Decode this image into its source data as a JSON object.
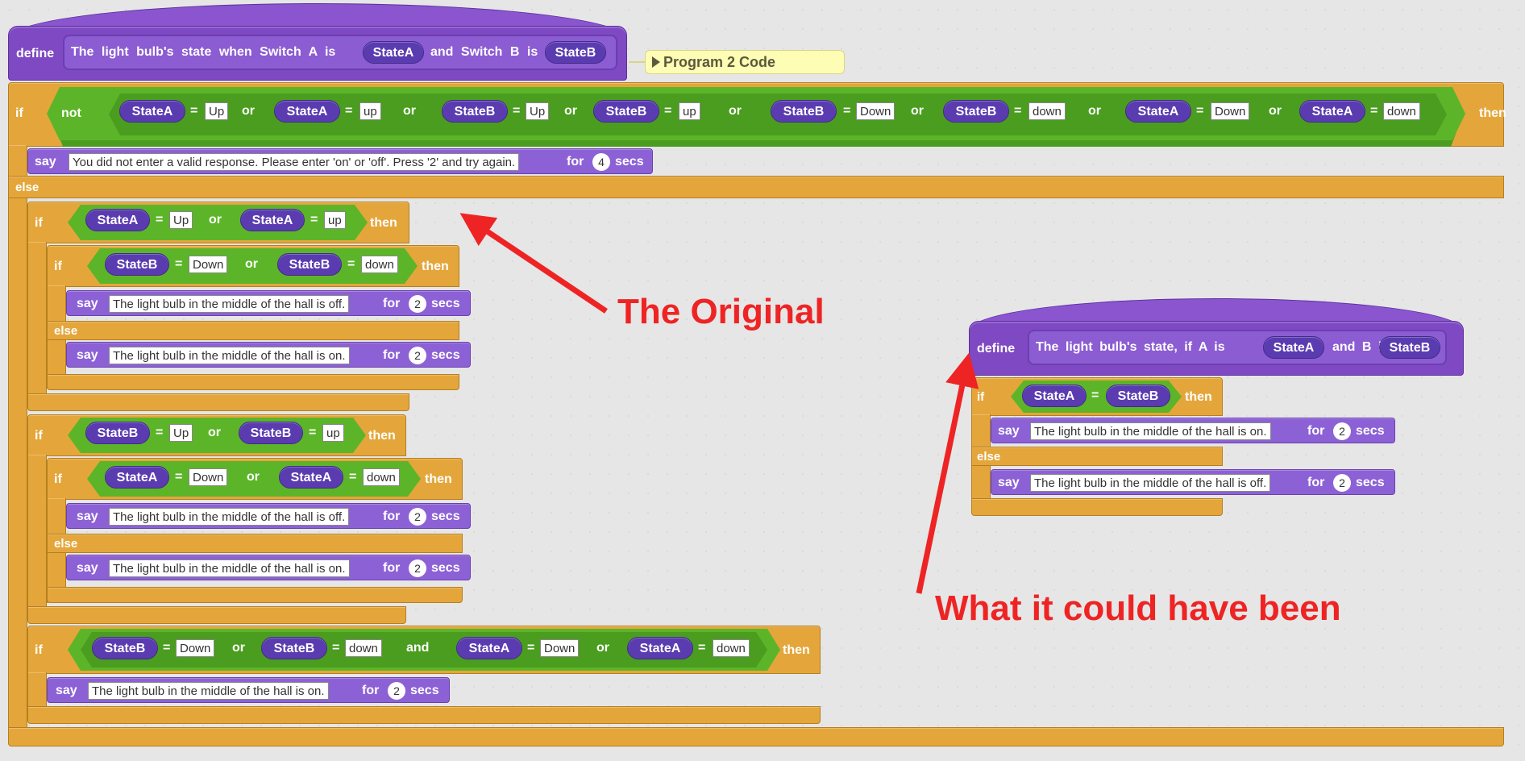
{
  "program1": {
    "define": "define",
    "proto_text": [
      "The light bulb's state when Switch A is",
      "and Switch B is"
    ],
    "proto_vars": [
      "StateA",
      "StateB"
    ],
    "note": "Program 2 Code",
    "if": "if",
    "then": "then",
    "else": "else",
    "not": "not",
    "or": "or",
    "and": "and",
    "eq": "=",
    "say": "say",
    "for": "for",
    "secs": "secs",
    "cond1_vars": [
      "StateA",
      "StateA",
      "StateB",
      "StateB",
      "StateB",
      "StateB",
      "StateA",
      "StateA"
    ],
    "cond1_vals": [
      "Up",
      "up",
      "Up",
      "up",
      "Down",
      "down",
      "Down",
      "down"
    ],
    "invalid_msg": "You did not enter a valid response. Please enter 'on' or 'off'. Press '2' and try again.",
    "invalid_secs": "4",
    "secs2": "2",
    "msg_off": "The light bulb in the middle of the hall is off.",
    "msg_on": "The light bulb in the middle of the hall is on.",
    "v_a": "StateA",
    "v_b": "StateB",
    "val_up": "Up",
    "val_up_l": "up",
    "val_down": "Down",
    "val_down_l": "down"
  },
  "program2": {
    "define": "define",
    "proto_text": [
      "The light bulb's state, if A is",
      "and B is"
    ],
    "proto_vars": [
      "StateA",
      "StateB"
    ],
    "if": "if",
    "then": "then",
    "else": "else",
    "eq": "=",
    "say": "say",
    "for": "for",
    "secs": "secs",
    "secs2": "2",
    "msg_on": "The light bulb in the middle of the hall is on.",
    "msg_off": "The light bulb in the middle of the hall is off.",
    "v_a": "StateA",
    "v_b": "StateB"
  },
  "annotations": {
    "original": "The Original",
    "could_have_been": "What it could have been"
  },
  "colors": {
    "control": "#e4a63b",
    "looks": "#8d61d6",
    "operators": "#5cb528",
    "custom": "#7e49c2",
    "annotation": "#ee2424"
  }
}
